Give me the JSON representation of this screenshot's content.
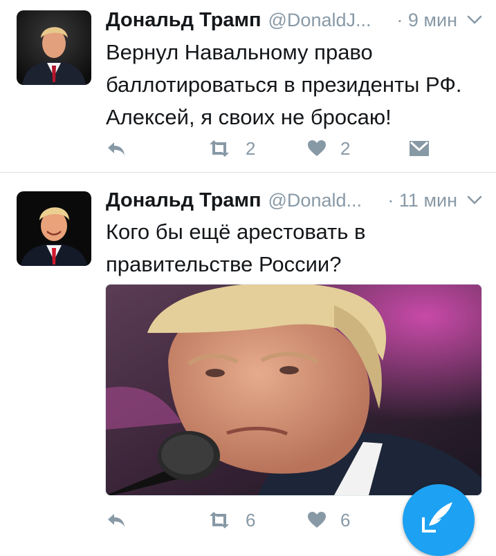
{
  "tweets": [
    {
      "author_name": "Дональд Трамп",
      "handle": "@DonaldJ...",
      "time": "· 9 мин",
      "text": "Вернул Навальному право баллотироваться в президенты РФ. Алексей, я своих не бросаю!",
      "retweets": "2",
      "likes": "2"
    },
    {
      "author_name": "Дональд Трамп",
      "handle": "@Donald...",
      "time": "· 11 мин",
      "text": "Кого бы ещё арестовать в правительстве России?",
      "retweets": "6",
      "likes": "6"
    }
  ],
  "icons": {
    "reply": "reply-icon",
    "retweet": "retweet-icon",
    "like": "heart-icon",
    "dm": "envelope-icon",
    "menu": "chevron-down-icon",
    "compose": "compose-quill-icon"
  },
  "colors": {
    "accent": "#1da1f2",
    "muted": "#8899a6",
    "text": "#14171a",
    "divider": "#dfe3e7"
  }
}
